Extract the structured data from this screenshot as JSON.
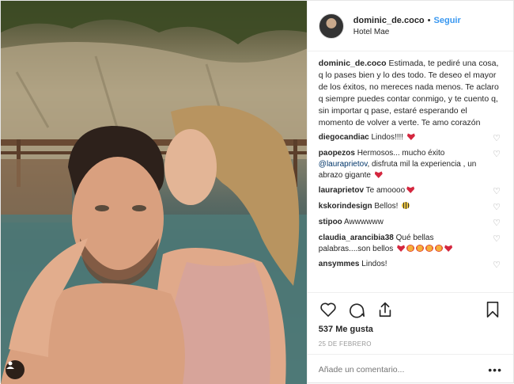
{
  "header": {
    "username": "dominic_de.coco",
    "separator": "•",
    "follow_label": "Seguir",
    "location": "Hotel Mae"
  },
  "caption": {
    "username": "dominic_de.coco",
    "text": "Estimada, te pediré una cosa, q lo pases bien y lo des todo. Te deseo el mayor de los éxitos, no mereces nada menos. Te aclaro q siempre puedes contar conmigo, y te cuento q, sin importar q pase, estaré esperando el momento de volver a verte. Te amo corazón"
  },
  "comments": [
    {
      "username": "diegocandiac",
      "text": "Lindos!!!! ",
      "emojis": [
        "heart"
      ]
    },
    {
      "username": "paopezos",
      "text": "Hermosos... mucho éxito ",
      "mention": "@lauraprietov",
      "text_after": ", disfruta mil la experiencia , un abrazo gigante ",
      "emojis": [
        "heart"
      ]
    },
    {
      "username": "lauraprietov",
      "text": "Te amoooo",
      "emojis": [
        "heart"
      ]
    },
    {
      "username": "kskorindesign",
      "text": "Bellos! ",
      "emojis": [
        "bee"
      ]
    },
    {
      "username": "stipoo",
      "text": "Awwwwww",
      "emojis": []
    },
    {
      "username": "claudia_arancibia38",
      "text": "Qué bellas palabras....son bellos ",
      "emojis": [
        "heart",
        "face",
        "face",
        "face",
        "face",
        "heart"
      ]
    },
    {
      "username": "ansymmes",
      "text": "Lindos!",
      "emojis": []
    }
  ],
  "likes": "537 Me gusta",
  "date": "25 DE FEBRERO",
  "add_comment": {
    "placeholder": "Añade un comentario..."
  },
  "more_label": "•••",
  "colors": {
    "link": "#3897f0",
    "text": "#262626",
    "muted": "#999999",
    "heart": "#d4273f"
  },
  "icons": [
    "heart-icon",
    "comment-icon",
    "share-icon",
    "bookmark-icon",
    "user-tag-icon",
    "more-options-icon"
  ]
}
